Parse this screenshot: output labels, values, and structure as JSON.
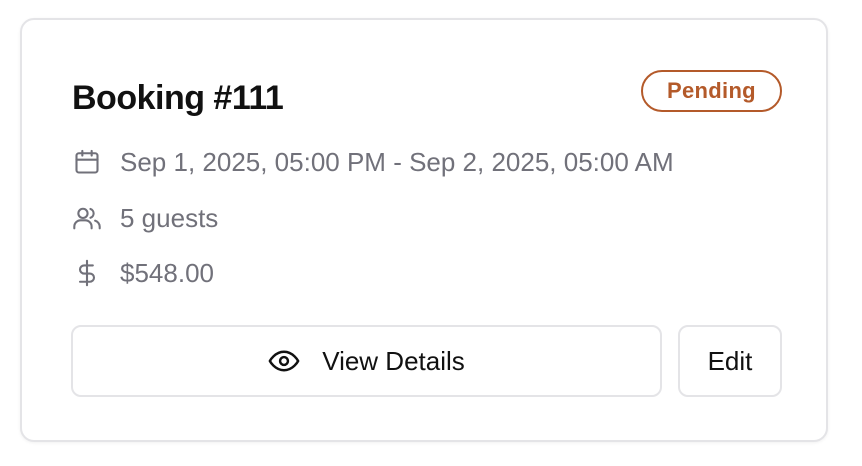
{
  "booking": {
    "title": "Booking #111",
    "status": "Pending",
    "date_range": "Sep 1, 2025, 05:00 PM - Sep 2, 2025, 05:00 AM",
    "guests": "5 guests",
    "price": "$548.00"
  },
  "actions": {
    "view_details_label": "View Details",
    "edit_label": "Edit"
  },
  "icons": {
    "date": "calendar-icon",
    "guests": "users-icon",
    "price": "dollar-icon",
    "view": "eye-icon"
  },
  "colors": {
    "status_pending": "#b45a2a",
    "muted_text": "#71717a",
    "border": "#e4e4e7",
    "title_text": "#111111"
  }
}
